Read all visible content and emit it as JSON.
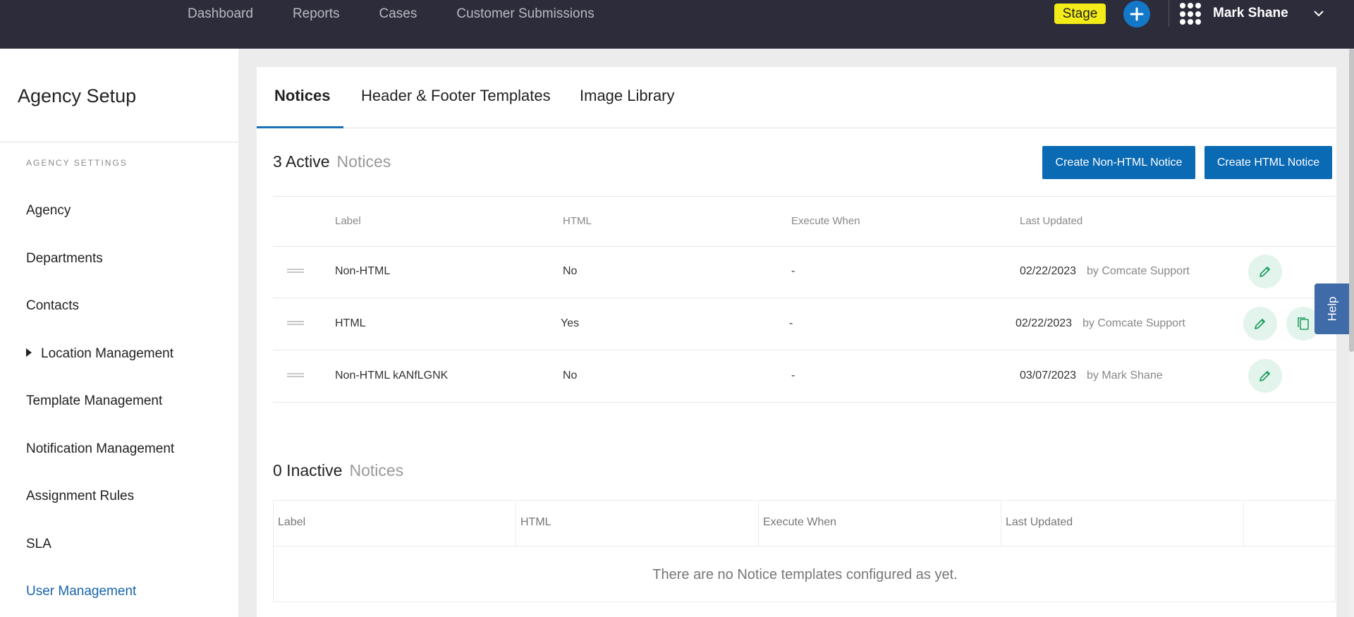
{
  "topnav": {
    "links": [
      "Dashboard",
      "Reports",
      "Cases",
      "Customer Submissions"
    ],
    "stage_label": "Stage",
    "user_name": "Mark Shane"
  },
  "sidebar": {
    "title": "Agency Setup",
    "section_label": "AGENCY SETTINGS",
    "items": [
      {
        "label": "Agency"
      },
      {
        "label": "Departments"
      },
      {
        "label": "Contacts"
      },
      {
        "label": "Location Management"
      },
      {
        "label": "Template Management"
      },
      {
        "label": "Notification Management"
      },
      {
        "label": "Assignment Rules"
      },
      {
        "label": "SLA"
      },
      {
        "label": "User Management"
      }
    ]
  },
  "tabs": [
    "Notices",
    "Header & Footer Templates",
    "Image Library"
  ],
  "active_section": {
    "count_label": "3 Active",
    "suffix": "Notices",
    "buttons": {
      "create_non_html": "Create Non-HTML Notice",
      "create_html": "Create HTML Notice"
    },
    "columns": [
      "Label",
      "HTML",
      "Execute When",
      "Last Updated"
    ],
    "rows": [
      {
        "label": "Non-HTML",
        "html": "No",
        "execute_when": "-",
        "date": "02/22/2023",
        "by": "by Comcate Support"
      },
      {
        "label": "HTML",
        "html": "Yes",
        "execute_when": "-",
        "date": "02/22/2023",
        "by": "by Comcate Support"
      },
      {
        "label": "Non-HTML kANfLGNK",
        "html": "No",
        "execute_when": "-",
        "date": "03/07/2023",
        "by": "by Mark Shane"
      }
    ]
  },
  "inactive_section": {
    "count_label": "0 Inactive",
    "suffix": "Notices",
    "columns": [
      "Label",
      "HTML",
      "Execute When",
      "Last Updated"
    ],
    "empty_message": "There are no Notice templates configured as yet."
  },
  "help_label": "Help",
  "colors": {
    "topbar": "#2d2c3b",
    "accent": "#0a6ab4",
    "stage": "#f3ec19",
    "active_link": "#1664ad"
  }
}
